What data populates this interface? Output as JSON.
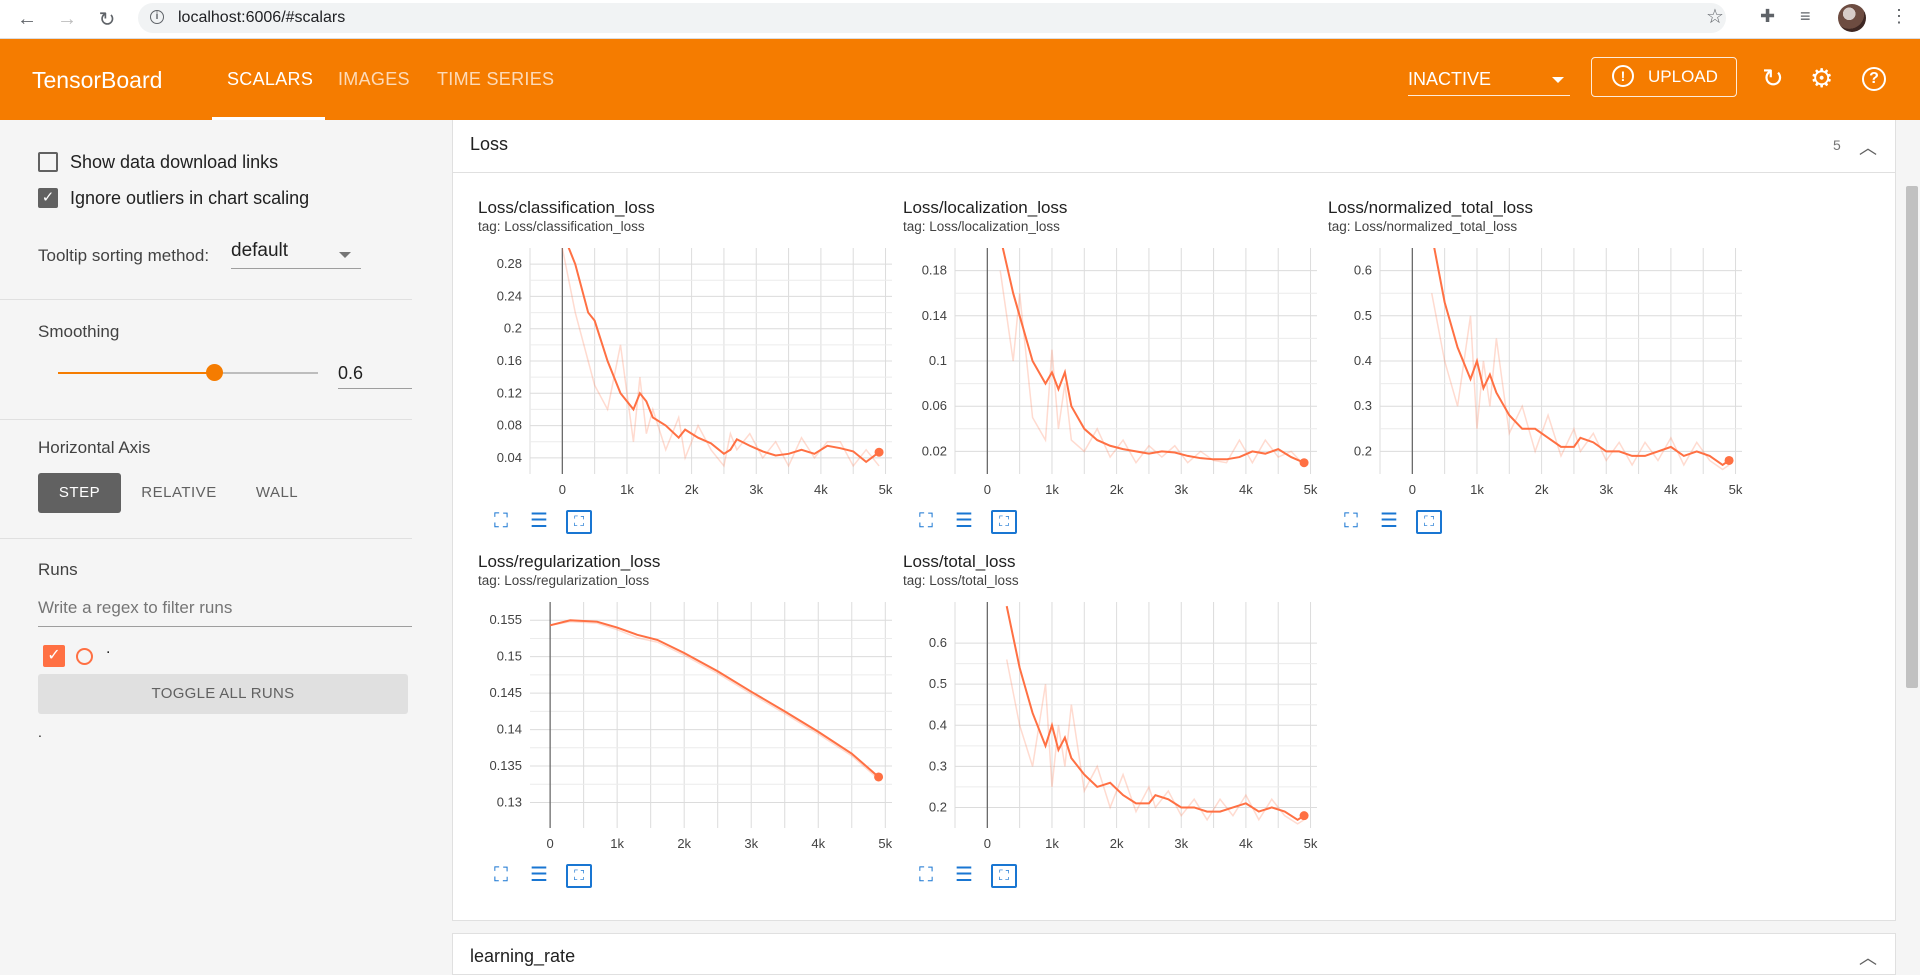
{
  "browser": {
    "url": "localhost:6006/#scalars"
  },
  "toolbar": {
    "brand": "TensorBoard",
    "tabs": [
      "SCALARS",
      "IMAGES",
      "TIME SERIES"
    ],
    "run_status": "INACTIVE",
    "upload_label": "UPLOAD"
  },
  "sidebar": {
    "show_download_links": "Show data download links",
    "ignore_outliers": "Ignore outliers in chart scaling",
    "tooltip_label": "Tooltip sorting method:",
    "tooltip_value": "default",
    "smoothing_label": "Smoothing",
    "smoothing_value": "0.6",
    "smoothing_fraction": 0.6,
    "horizontal_axis_label": "Horizontal Axis",
    "axis_options": [
      "STEP",
      "RELATIVE",
      "WALL"
    ],
    "runs_label": "Runs",
    "regex_placeholder": "Write a regex to filter runs",
    "run_name": ".",
    "toggle_all": "TOGGLE ALL RUNS",
    "footer_dot": "."
  },
  "main": {
    "section_title": "Loss",
    "section_count": "5",
    "next_section_title": "learning_rate"
  },
  "colors": {
    "accent": "#f57c00",
    "series": "#ff7043"
  },
  "chart_data": [
    {
      "type": "line",
      "title": "Loss/classification_loss",
      "tag": "tag: Loss/classification_loss",
      "x_ticks": [
        "0",
        "1k",
        "2k",
        "3k",
        "4k",
        "5k"
      ],
      "y_ticks": [
        "0.04",
        "0.08",
        "0.12",
        "0.16",
        "0.2",
        "0.24",
        "0.28"
      ],
      "xlim": [
        -500,
        5100
      ],
      "ylim": [
        0.02,
        0.3
      ],
      "x": [
        0,
        200,
        400,
        500,
        700,
        900,
        1100,
        1200,
        1300,
        1400,
        1600,
        1800,
        1900,
        2100,
        2300,
        2500,
        2600,
        2700,
        2900,
        3100,
        3300,
        3500,
        3700,
        3900,
        4100,
        4300,
        4500,
        4700,
        4900
      ],
      "smoothed": [
        0.32,
        0.28,
        0.22,
        0.21,
        0.16,
        0.12,
        0.1,
        0.12,
        0.11,
        0.09,
        0.08,
        0.065,
        0.075,
        0.065,
        0.058,
        0.045,
        0.05,
        0.063,
        0.055,
        0.048,
        0.043,
        0.045,
        0.05,
        0.045,
        0.055,
        0.052,
        0.048,
        0.035,
        0.047
      ],
      "raw": [
        0.3,
        0.22,
        0.16,
        0.13,
        0.1,
        0.18,
        0.06,
        0.14,
        0.07,
        0.1,
        0.05,
        0.09,
        0.04,
        0.08,
        0.05,
        0.03,
        0.07,
        0.05,
        0.07,
        0.04,
        0.06,
        0.03,
        0.065,
        0.04,
        0.06,
        0.06,
        0.03,
        0.05,
        0.03
      ]
    },
    {
      "type": "line",
      "title": "Loss/localization_loss",
      "tag": "tag: Loss/localization_loss",
      "x_ticks": [
        "0",
        "1k",
        "2k",
        "3k",
        "4k",
        "5k"
      ],
      "y_ticks": [
        "0.02",
        "0.06",
        "0.1",
        "0.14",
        "0.18"
      ],
      "xlim": [
        -500,
        5100
      ],
      "ylim": [
        0.0,
        0.2
      ],
      "x": [
        200,
        400,
        500,
        700,
        900,
        1000,
        1100,
        1200,
        1300,
        1500,
        1700,
        1900,
        2100,
        2300,
        2500,
        2700,
        2900,
        3100,
        3300,
        3500,
        3700,
        3900,
        4100,
        4300,
        4500,
        4700,
        4900
      ],
      "smoothed": [
        0.21,
        0.16,
        0.14,
        0.1,
        0.08,
        0.09,
        0.075,
        0.09,
        0.06,
        0.04,
        0.03,
        0.025,
        0.022,
        0.02,
        0.018,
        0.02,
        0.019,
        0.016,
        0.014,
        0.013,
        0.013,
        0.015,
        0.02,
        0.018,
        0.022,
        0.015,
        0.01
      ],
      "raw": [
        0.18,
        0.1,
        0.16,
        0.05,
        0.03,
        0.11,
        0.04,
        0.08,
        0.03,
        0.02,
        0.04,
        0.015,
        0.03,
        0.01,
        0.025,
        0.015,
        0.025,
        0.01,
        0.02,
        0.012,
        0.01,
        0.03,
        0.01,
        0.03,
        0.015,
        0.02,
        0.008
      ]
    },
    {
      "type": "line",
      "title": "Loss/normalized_total_loss",
      "tag": "tag: Loss/normalized_total_loss",
      "x_ticks": [
        "0",
        "1k",
        "2k",
        "3k",
        "4k",
        "5k"
      ],
      "y_ticks": [
        "0.2",
        "0.3",
        "0.4",
        "0.5",
        "0.6"
      ],
      "xlim": [
        -500,
        5100
      ],
      "ylim": [
        0.15,
        0.65
      ],
      "x": [
        300,
        500,
        700,
        900,
        1000,
        1100,
        1200,
        1300,
        1500,
        1700,
        1900,
        2100,
        2300,
        2500,
        2600,
        2800,
        3000,
        3200,
        3400,
        3600,
        3800,
        4000,
        4200,
        4400,
        4600,
        4800,
        4900
      ],
      "smoothed": [
        0.68,
        0.53,
        0.43,
        0.36,
        0.4,
        0.34,
        0.37,
        0.33,
        0.28,
        0.25,
        0.25,
        0.23,
        0.21,
        0.21,
        0.23,
        0.22,
        0.2,
        0.2,
        0.19,
        0.19,
        0.2,
        0.21,
        0.19,
        0.2,
        0.19,
        0.17,
        0.18
      ],
      "raw": [
        0.55,
        0.4,
        0.3,
        0.5,
        0.25,
        0.4,
        0.3,
        0.45,
        0.24,
        0.3,
        0.2,
        0.28,
        0.19,
        0.25,
        0.2,
        0.24,
        0.18,
        0.22,
        0.17,
        0.22,
        0.18,
        0.23,
        0.17,
        0.22,
        0.18,
        0.16,
        0.17
      ]
    },
    {
      "type": "line",
      "title": "Loss/regularization_loss",
      "tag": "tag: Loss/regularization_loss",
      "x_ticks": [
        "0",
        "1k",
        "2k",
        "3k",
        "4k",
        "5k"
      ],
      "y_ticks": [
        "0.13",
        "0.135",
        "0.14",
        "0.145",
        "0.15",
        "0.155"
      ],
      "xlim": [
        -300,
        5100
      ],
      "ylim": [
        0.1265,
        0.1575
      ],
      "x": [
        0,
        300,
        700,
        1000,
        1300,
        1600,
        2000,
        2500,
        3000,
        3500,
        4000,
        4500,
        4900
      ],
      "smoothed": [
        0.1543,
        0.155,
        0.1548,
        0.154,
        0.153,
        0.1523,
        0.1505,
        0.148,
        0.1452,
        0.1425,
        0.1397,
        0.1367,
        0.1335
      ],
      "raw": [
        0.1543,
        0.1548,
        0.1546,
        0.1537,
        0.1526,
        0.152,
        0.1502,
        0.1477,
        0.1449,
        0.1422,
        0.1394,
        0.1364,
        0.1332
      ]
    },
    {
      "type": "line",
      "title": "Loss/total_loss",
      "tag": "tag: Loss/total_loss",
      "x_ticks": [
        "0",
        "1k",
        "2k",
        "3k",
        "4k",
        "5k"
      ],
      "y_ticks": [
        "0.2",
        "0.3",
        "0.4",
        "0.5",
        "0.6"
      ],
      "xlim": [
        -500,
        5100
      ],
      "ylim": [
        0.15,
        0.7
      ],
      "x": [
        300,
        500,
        700,
        900,
        1000,
        1100,
        1200,
        1300,
        1500,
        1700,
        1900,
        2100,
        2300,
        2500,
        2600,
        2800,
        3000,
        3200,
        3400,
        3600,
        3800,
        4000,
        4200,
        4400,
        4600,
        4800,
        4900
      ],
      "smoothed": [
        0.69,
        0.54,
        0.43,
        0.35,
        0.4,
        0.34,
        0.37,
        0.32,
        0.28,
        0.25,
        0.26,
        0.23,
        0.21,
        0.21,
        0.23,
        0.22,
        0.2,
        0.2,
        0.19,
        0.19,
        0.2,
        0.21,
        0.19,
        0.2,
        0.19,
        0.17,
        0.18
      ],
      "raw": [
        0.56,
        0.4,
        0.3,
        0.5,
        0.25,
        0.4,
        0.3,
        0.45,
        0.24,
        0.3,
        0.2,
        0.28,
        0.19,
        0.25,
        0.2,
        0.24,
        0.18,
        0.22,
        0.17,
        0.22,
        0.18,
        0.23,
        0.17,
        0.22,
        0.18,
        0.16,
        0.17
      ]
    }
  ]
}
